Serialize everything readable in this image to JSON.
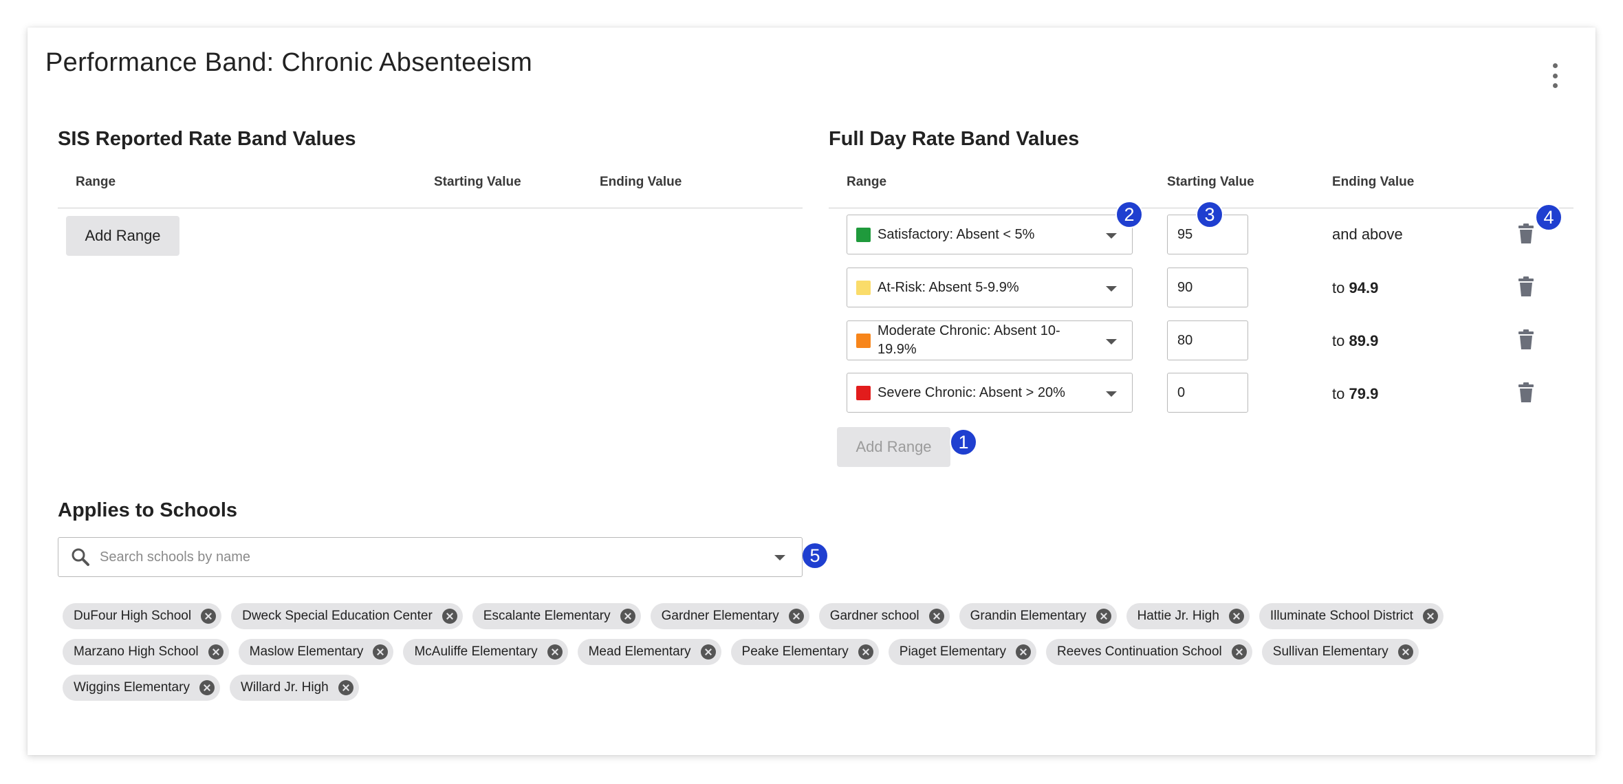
{
  "header": {
    "title": "Performance Band: Chronic Absenteeism"
  },
  "sis_section": {
    "title": "SIS Reported Rate Band Values",
    "columns": {
      "range": "Range",
      "start": "Starting Value",
      "end": "Ending Value"
    },
    "add_range_label": "Add Range"
  },
  "full_day_section": {
    "title": "Full Day Rate Band Values",
    "columns": {
      "range": "Range",
      "start": "Starting Value",
      "end": "Ending Value"
    },
    "rows": [
      {
        "label": "Satisfactory: Absent < 5%",
        "color": "#1f9a3c",
        "start": "95",
        "end_prefix": "and above",
        "end_value": ""
      },
      {
        "label": "At-Risk: Absent 5-9.9%",
        "color": "#fadc6a",
        "start": "90",
        "end_prefix": "to",
        "end_value": "94.9"
      },
      {
        "label": "Moderate Chronic: Absent 10-19.9%",
        "color": "#f7851a",
        "start": "80",
        "end_prefix": "to",
        "end_value": "89.9"
      },
      {
        "label": "Severe Chronic: Absent > 20%",
        "color": "#e21c1c",
        "start": "0",
        "end_prefix": "to",
        "end_value": "79.9"
      }
    ],
    "add_range_label": "Add Range"
  },
  "annotations": {
    "b1": "1",
    "b2": "2",
    "b3": "3",
    "b4": "4",
    "b5": "5"
  },
  "schools": {
    "title": "Applies to Schools",
    "search_placeholder": "Search schools by name",
    "chips_row1": [
      "DuFour High School",
      "Dweck Special Education Center",
      "Escalante Elementary",
      "Gardner Elementary",
      "Gardner school",
      "Grandin Elementary",
      "Hattie Jr. High",
      "Illuminate School District"
    ],
    "chips_row2": [
      "Marzano High School",
      "Maslow Elementary",
      "McAuliffe Elementary",
      "Mead Elementary",
      "Peake Elementary",
      "Piaget Elementary",
      "Reeves Continuation School",
      "Sullivan Elementary"
    ],
    "chips_row3": [
      "Wiggins Elementary",
      "Willard Jr. High"
    ]
  },
  "icons": {
    "menu": "kebab-menu-icon",
    "delete": "trash-icon",
    "search": "search-icon",
    "dropdown": "chevron-down-icon",
    "remove": "close-circle-icon"
  }
}
